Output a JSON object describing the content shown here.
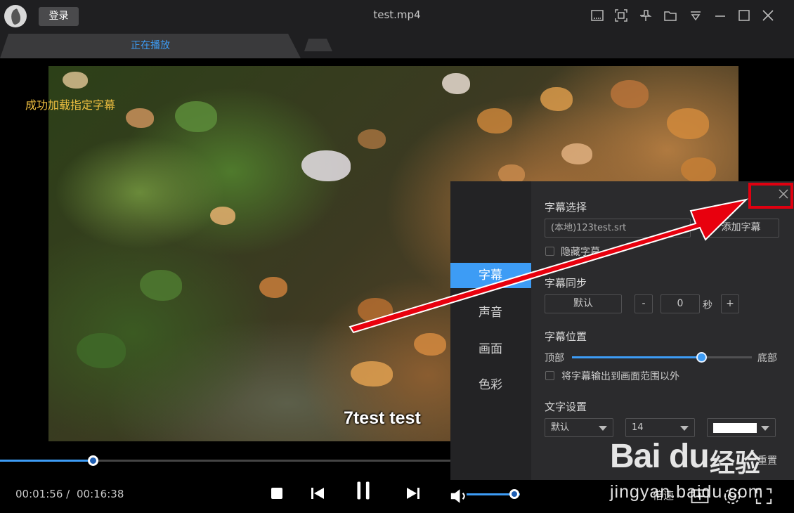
{
  "titlebar": {
    "login_label": "登录",
    "title": "test.mp4",
    "icons": [
      "mini-player-icon",
      "fullscreen-frame-icon",
      "pin-icon",
      "open-folder-icon",
      "menu-dropdown-icon",
      "minimize-icon",
      "maximize-icon",
      "close-icon"
    ]
  },
  "tabs": {
    "active_label": "正在播放"
  },
  "video": {
    "status_message": "成功加载指定字幕",
    "subtitle_text": "7test test"
  },
  "subtitle_panel": {
    "nav": [
      "字幕",
      "声音",
      "画面",
      "色彩"
    ],
    "active_nav": "字幕",
    "selection": {
      "label": "字幕选择",
      "current_file": "(本地)123test.srt",
      "add_button": "添加字幕",
      "hide_checkbox_label": "隐藏字幕"
    },
    "sync": {
      "label": "字幕同步",
      "default_button": "默认",
      "minus": "-",
      "value": "0",
      "unit": "秒",
      "plus": "+"
    },
    "position": {
      "label": "字幕位置",
      "left_label": "顶部",
      "right_label": "底部",
      "level_fraction": 0.72,
      "outside_checkbox_label": "将字幕输出到画面范围以外"
    },
    "text_settings": {
      "label": "文字设置",
      "font": "默认",
      "size": "14",
      "color": "#ffffff"
    },
    "reset_label": "重置"
  },
  "playback": {
    "current_time": "00:01:56 /",
    "total_time": "00:16:38",
    "progress_fraction": 0.206,
    "volume_fraction": 0.88,
    "speed_label": "倍速"
  },
  "watermark": {
    "logo": "Bai du",
    "cn": "经验",
    "url": "jingyan.baidu.com"
  },
  "colors": {
    "accent": "#3d9cf5",
    "highlight": "#e00010",
    "status": "#f0c040"
  }
}
